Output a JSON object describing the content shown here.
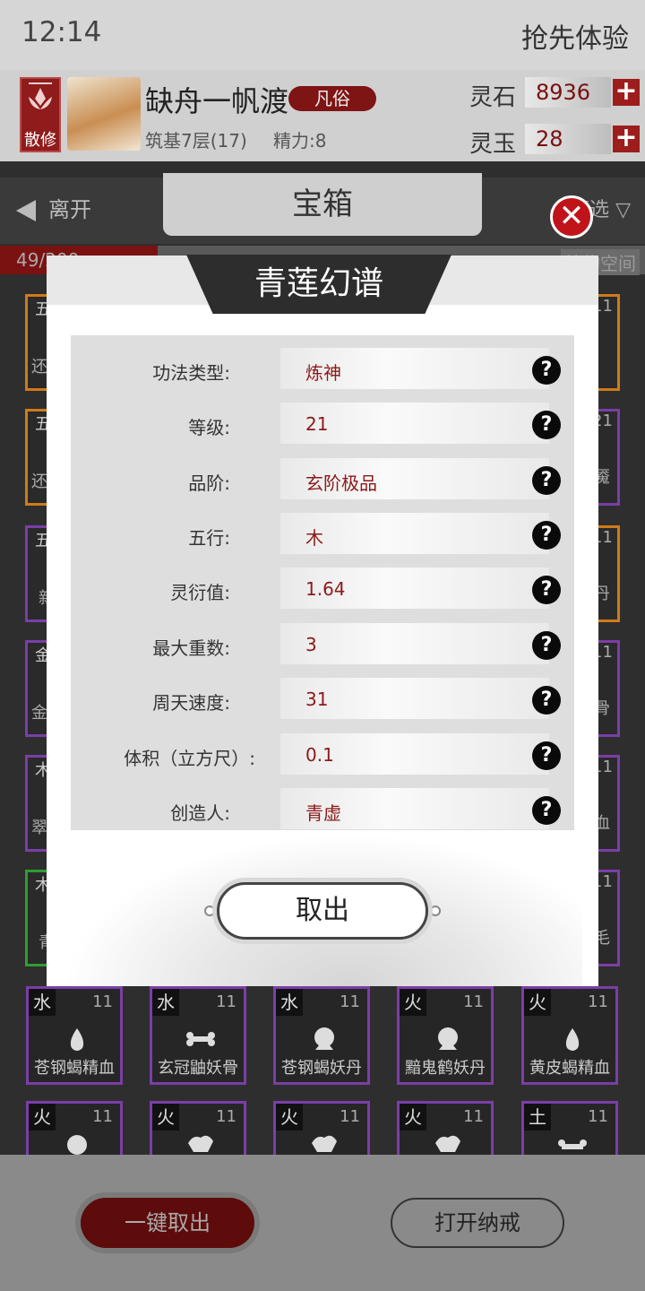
{
  "status": {
    "time": "12:14",
    "trial": "抢先体验"
  },
  "profile": {
    "badge": "散修",
    "name": "缺舟一帆渡",
    "rank": "凡俗",
    "level": "筑基7层(17)",
    "energy": "精力:8",
    "currencies": [
      {
        "label": "灵石",
        "value": "8936"
      },
      {
        "label": "灵玉",
        "value": "28"
      }
    ]
  },
  "nav": {
    "leave": "离开",
    "tab": "宝箱",
    "filter": "筛选",
    "count": "49/200",
    "expand": "储物空间"
  },
  "side_left": [
    "五",
    "还",
    "五",
    "还",
    "五",
    "新",
    "金",
    "金",
    "木",
    "翠",
    "木",
    "青"
  ],
  "side_right": [
    "11",
    "21",
    "魇",
    "11",
    "丹",
    "11",
    "骨",
    "11",
    "血",
    "11",
    "毛"
  ],
  "grid": [
    {
      "el": "水",
      "lv": "11",
      "name": "苍钢蝎精血",
      "icon": "drop"
    },
    {
      "el": "水",
      "lv": "11",
      "name": "玄冠鼬妖骨",
      "icon": "bone"
    },
    {
      "el": "水",
      "lv": "11",
      "name": "苍钢蝎妖丹",
      "icon": "orb"
    },
    {
      "el": "火",
      "lv": "11",
      "name": "黯鬼鹤妖丹",
      "icon": "orb"
    },
    {
      "el": "火",
      "lv": "11",
      "name": "黄皮蝎精血",
      "icon": "drop"
    },
    {
      "el": "火",
      "lv": "11",
      "name": "",
      "icon": "orb"
    },
    {
      "el": "火",
      "lv": "11",
      "name": "",
      "icon": "pelt"
    },
    {
      "el": "火",
      "lv": "11",
      "name": "",
      "icon": "pelt"
    },
    {
      "el": "火",
      "lv": "11",
      "name": "",
      "icon": "pelt"
    },
    {
      "el": "土",
      "lv": "11",
      "name": "",
      "icon": "bone"
    }
  ],
  "bottom": {
    "take_all": "一键取出",
    "open_ring": "打开纳戒"
  },
  "modal": {
    "title": "青莲幻谱",
    "rows": [
      {
        "label": "功法类型:",
        "value": "炼神"
      },
      {
        "label": "等级:",
        "value": "21"
      },
      {
        "label": "品阶:",
        "value": "玄阶极品"
      },
      {
        "label": "五行:",
        "value": "木"
      },
      {
        "label": "灵衍值:",
        "value": "1.64"
      },
      {
        "label": "最大重数:",
        "value": "3"
      },
      {
        "label": "周天速度:",
        "value": "31"
      },
      {
        "label": "体积（立方尺）:",
        "value": "0.1"
      },
      {
        "label": "创造人:",
        "value": "青虚"
      }
    ],
    "take_button": "取出",
    "help_glyph": "?"
  },
  "colors": {
    "accent": "#8b1a1a",
    "purple_border": "#7b3ea8",
    "orange_border": "#d07a1a",
    "green_border": "#2e9d2e"
  }
}
